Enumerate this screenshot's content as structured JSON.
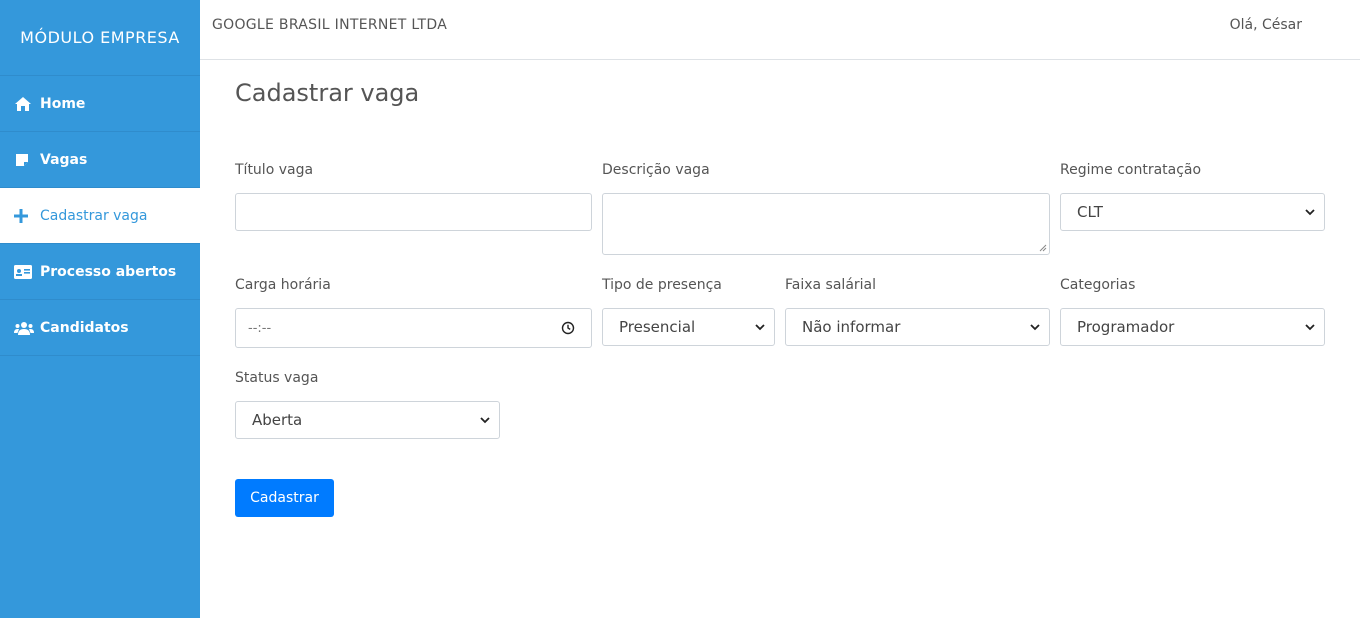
{
  "sidebar": {
    "brand": "MÓDULO EMPRESA",
    "items": [
      {
        "label": "Home",
        "icon": "home-icon"
      },
      {
        "label": "Vagas",
        "icon": "note-icon"
      },
      {
        "label": "Cadastrar vaga",
        "icon": "plus-icon",
        "active": true
      },
      {
        "label": "Processo abertos",
        "icon": "id-card-icon"
      },
      {
        "label": "Candidatos",
        "icon": "users-icon"
      }
    ]
  },
  "header": {
    "company": "GOOGLE BRASIL INTERNET LTDA",
    "greeting": "Olá, César"
  },
  "main": {
    "title": "Cadastrar vaga",
    "form": {
      "titulo": {
        "label": "Título vaga",
        "value": ""
      },
      "descricao": {
        "label": "Descrição vaga",
        "value": ""
      },
      "regime": {
        "label": "Regime contratação",
        "value": "CLT"
      },
      "carga": {
        "label": "Carga horária",
        "placeholder": "--:--"
      },
      "presenca": {
        "label": "Tipo de presença",
        "value": "Presencial"
      },
      "faixa": {
        "label": "Faixa salárial",
        "value": "Não informar"
      },
      "categorias": {
        "label": "Categorias",
        "value": "Programador"
      },
      "status": {
        "label": "Status vaga",
        "value": "Aberta"
      }
    },
    "submit_label": "Cadastrar"
  },
  "colors": {
    "sidebar_bg": "#3498db",
    "primary_button": "#007bff"
  }
}
